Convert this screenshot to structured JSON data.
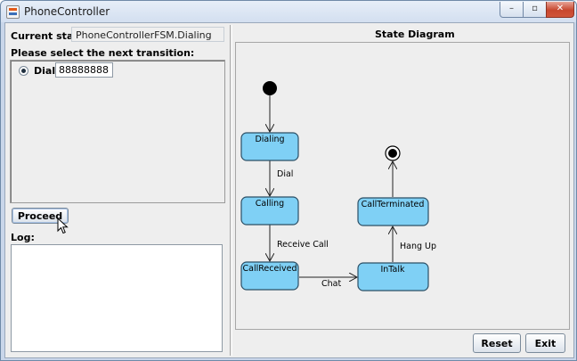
{
  "window": {
    "title": "PhoneController",
    "minimize_glyph": "–",
    "maximize_glyph": "▫",
    "close_glyph": "✕"
  },
  "current_state": {
    "label": "Current state:",
    "value": "PhoneControllerFSM.Dialing"
  },
  "transitions": {
    "label": "Please select the next transition:",
    "items": [
      {
        "label": "Dial",
        "value": "88888888",
        "selected": true
      }
    ]
  },
  "proceed_label": "Proceed",
  "log": {
    "label": "Log:",
    "content": ""
  },
  "diagram": {
    "title": "State Diagram",
    "states": [
      "Dialing",
      "Calling",
      "CallReceived",
      "InTalk",
      "CallTerminated"
    ],
    "transitions": [
      {
        "from": "Dialing",
        "to": "Calling",
        "label": "Dial"
      },
      {
        "from": "Calling",
        "to": "CallReceived",
        "label": "Receive Call"
      },
      {
        "from": "CallReceived",
        "to": "InTalk",
        "label": "Chat"
      },
      {
        "from": "InTalk",
        "to": "CallTerminated",
        "label": "Hang Up"
      }
    ],
    "state_fill": "#7fd0f5",
    "state_stroke": "#2b4f66"
  },
  "buttons": {
    "reset": "Reset",
    "exit": "Exit"
  }
}
